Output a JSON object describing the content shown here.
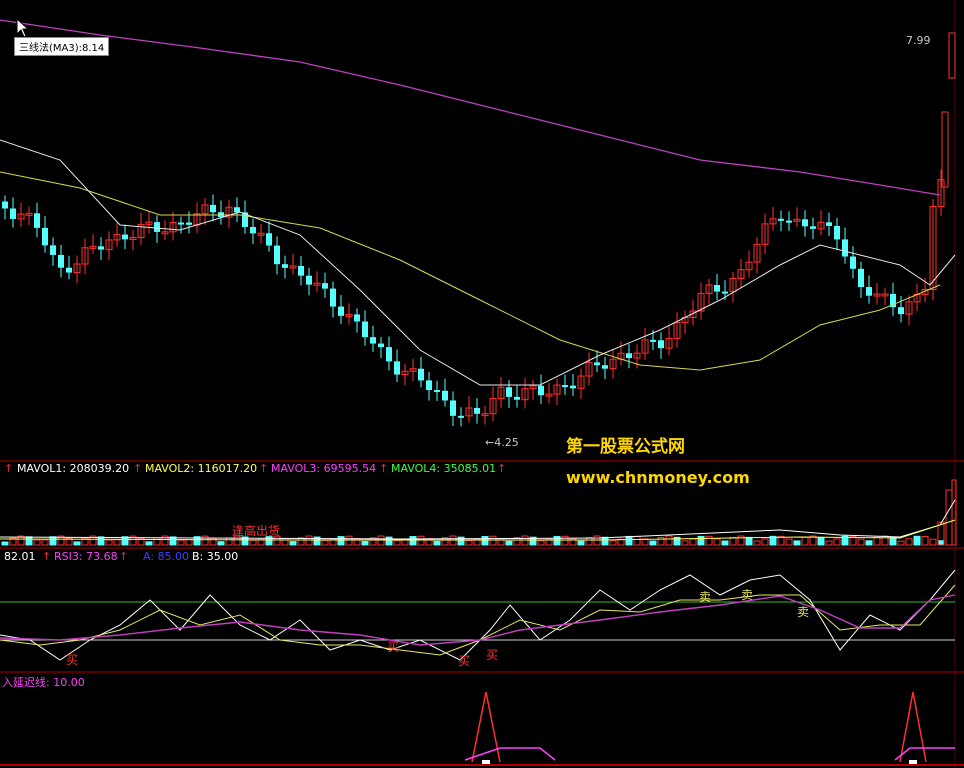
{
  "overlay": {
    "ma_tag": "三线法(MA3):8.14",
    "high_label": "7.99",
    "low_label": "←4.25",
    "watermark_title": "第一股票公式网",
    "watermark_url": "www.chnmoney.com"
  },
  "volume_header": {
    "arrow": "↑",
    "items": [
      {
        "label": "MAVOL1: 208039.20",
        "color": "#ffffff"
      },
      {
        "label": "MAVOL2: 116017.20",
        "color": "#ffff60"
      },
      {
        "label": "MAVOL3: 69595.54",
        "color": "#ff40ff"
      },
      {
        "label": "MAVOL4: 35085.01",
        "color": "#40ff40"
      }
    ],
    "signal_text": "逢高出货"
  },
  "rsi_header": {
    "arrow": "↑",
    "items": [
      {
        "label": "82.01",
        "color": "#ffffff"
      },
      {
        "label": "RSI3: 73.68",
        "color": "#ff40ff"
      },
      {
        "label": "A: 85.00",
        "color": "#4040ff"
      },
      {
        "label": "B: 35.00",
        "color": "#ffffff"
      }
    ],
    "buy_labels": [
      "买",
      "买",
      "买",
      "买"
    ],
    "sell_labels": [
      "卖",
      "卖",
      "卖"
    ]
  },
  "delay_header": {
    "label": "入延迟线: 10.00",
    "color": "#ff40ff"
  },
  "colors": {
    "up": "#ff3030",
    "down": "#54ffff",
    "ma_long": "#c040c0",
    "ma_mid": "#d8d850",
    "ma_short": "#e8e8e8",
    "panel_border": "#b00000"
  },
  "chart_data": {
    "type": "candlestick",
    "price_extremes": {
      "high": 7.99,
      "low": 4.25
    },
    "ma3_value": 8.14,
    "indicator_levels": {
      "A": 85.0,
      "B": 35.0
    }
  }
}
